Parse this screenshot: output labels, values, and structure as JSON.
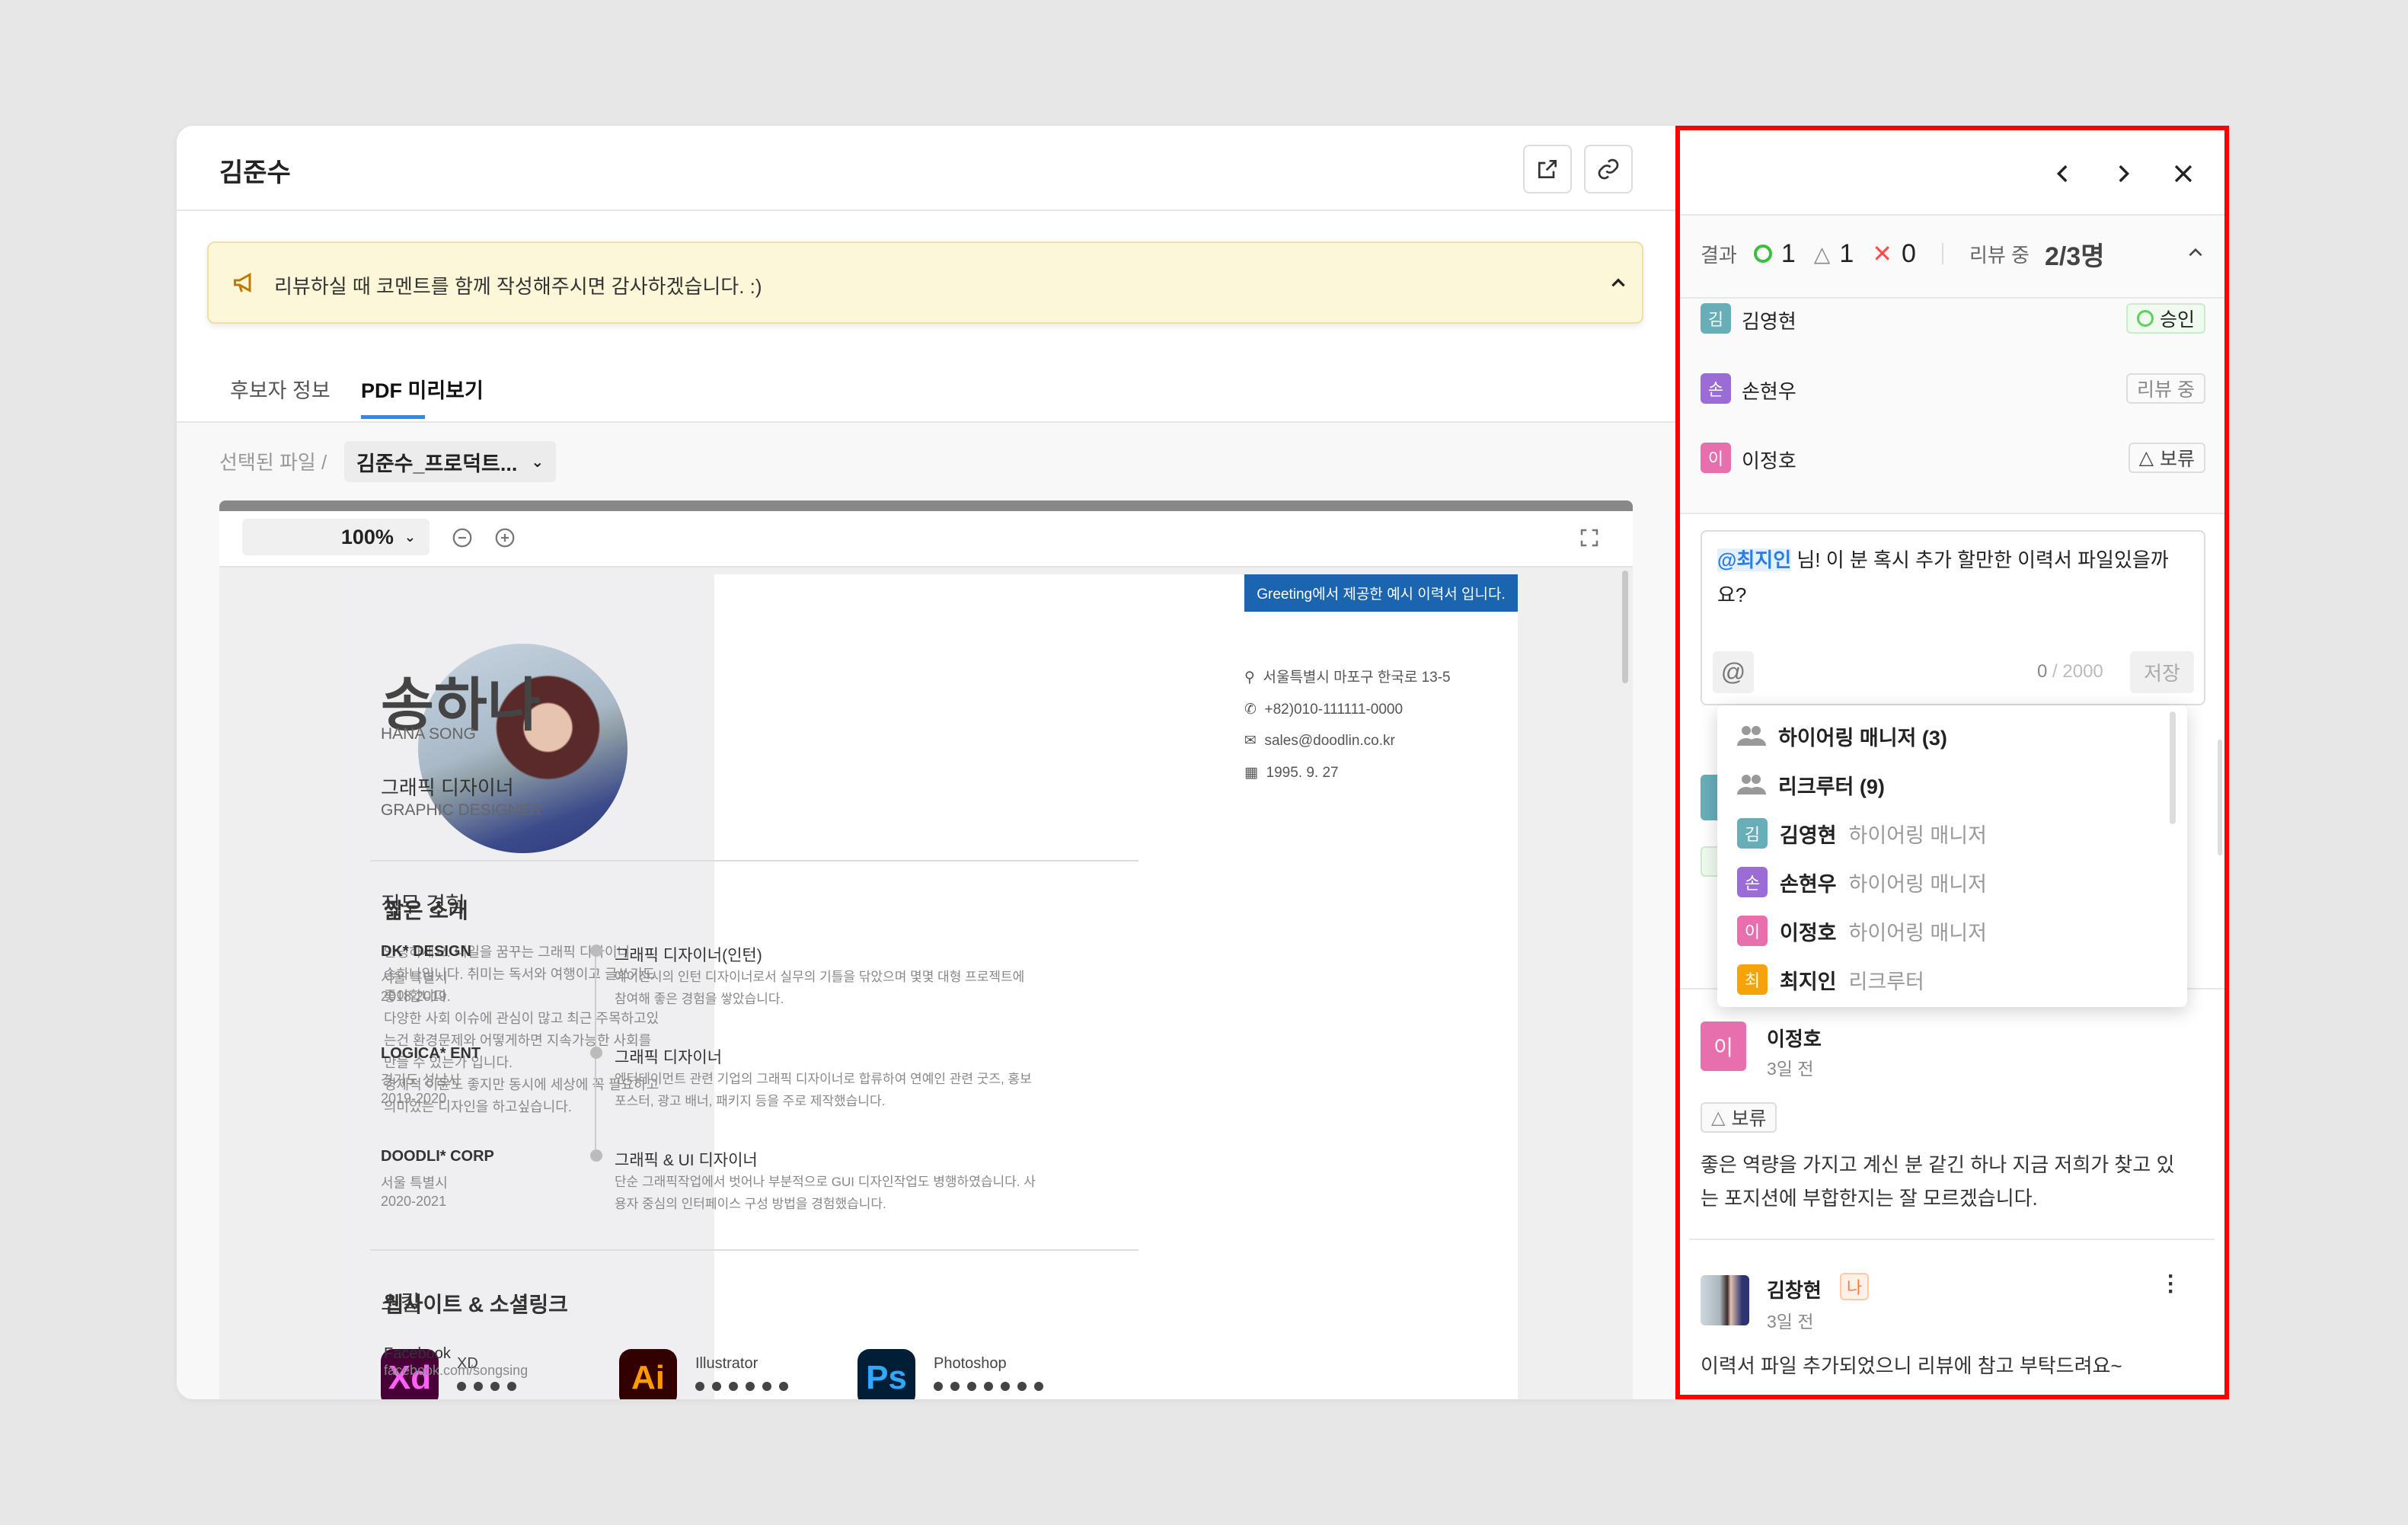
{
  "header": {
    "title": "김준수",
    "icons": [
      "external-link-icon",
      "link-icon"
    ]
  },
  "notice": {
    "text": "리뷰하실 때 코멘트를 함께 작성해주시면 감사하겠습니다. :)",
    "icon": "megaphone-icon"
  },
  "tabs": [
    {
      "label": "후보자 정보"
    },
    {
      "label": "PDF 미리보기",
      "active": true
    }
  ],
  "file_selector": {
    "label": "선택된 파일 /",
    "value": "김준수_프로덕트..."
  },
  "viewer": {
    "zoom": "100%"
  },
  "resume": {
    "banner": "Greeting에서 제공한 예시 이력서 입니다.",
    "name": "송하나",
    "name_en": "HANA SONG",
    "title": "그래픽 디자이너",
    "title_en": "GRAPHIC DESIGNER",
    "contacts": [
      {
        "icon": "location-icon",
        "text": "서울특별시 마포구 한국로 13-5"
      },
      {
        "icon": "phone-icon",
        "text": "+82)010-111111-0000"
      },
      {
        "icon": "mail-icon",
        "text": "sales@doodlin.co.kr"
      },
      {
        "icon": "calendar-icon",
        "text": "1995. 9. 27"
      }
    ],
    "intro_title": "짧은 소개",
    "intro_lines": [
      "안녕하세요. 내일을 꿈꾸는 그래픽 디자이너",
      "송하나입니다. 취미는 독서와 여행이고 글쓰기도",
      "좋아합니다.",
      "다양한 사회 이슈에 관심이 많고 최근 주목하고있",
      "는건 환경문제와 어떻게하면 지속가능한 사회를",
      "만들 수 있는가 입니다.",
      "경제적 이윤도 좋지만 동시에 세상에 꼭 필요하고",
      "의미있는 디자인을 하고싶습니다."
    ],
    "links_title": "웹사이트 & 소셜링크",
    "links": [
      {
        "name": "Facebook",
        "url": "facebook.com/songsing"
      }
    ],
    "experience_title": "직무 경험",
    "experience": [
      {
        "company": "DK* DESIGN",
        "location": "서울 특별시",
        "period": "2018-2019",
        "role": "그래픽 디자이너(인턴)",
        "desc1": "에이전시의 인턴 디자이너로서 실무의 기틀을 닦았으며 몇몇 대형 프로젝트에",
        "desc2": "참여해 좋은 경험을 쌓았습니다."
      },
      {
        "company": "LOGICA* ENT",
        "location": "경기도 성남시",
        "period": "2019-2020",
        "role": "그래픽 디자이너",
        "desc1": "엔터테이먼트 관련 기업의 그래픽 디자이너로 합류하여 연예인 관련 굿즈, 홍보",
        "desc2": "포스터, 광고 배너, 패키지 등을 주로 제작했습니다."
      },
      {
        "company": "DOODLI* CORP",
        "location": "서울 특별시",
        "period": "2020-2021",
        "role": "그래픽 & UI 디자이너",
        "desc1": "단순 그래픽작업에서 벗어나 부분적으로 GUI 디자인작업도 병행하였습니다. 사",
        "desc2": "용자 중심의 인터페이스 구성 방법을 경험했습니다."
      }
    ],
    "skills_title": "스킬",
    "skills": [
      {
        "logo": "Xd",
        "name": "XD",
        "level": 4,
        "bg": "#470137",
        "fg": "#ff61f6"
      },
      {
        "logo": "Ai",
        "name": "Illustrator",
        "level": 6,
        "bg": "#330000",
        "fg": "#ff9a00"
      },
      {
        "logo": "Ps",
        "name": "Photoshop",
        "level": 7,
        "bg": "#001e36",
        "fg": "#31a8ff"
      }
    ]
  },
  "panel": {
    "summary": {
      "label": "결과",
      "approve": "1",
      "hold": "1",
      "reject": "0",
      "reviewing_label": "리뷰 중",
      "reviewing": "2/3명"
    },
    "reviewers": [
      {
        "initial": "김",
        "name": "김영현",
        "status": "승인",
        "color": "#67aeb9"
      },
      {
        "initial": "손",
        "name": "손현우",
        "status": "리뷰 중",
        "color": "#9b6cd6"
      },
      {
        "initial": "이",
        "name": "이정호",
        "status": "보류",
        "color": "#e86fae"
      }
    ],
    "composer": {
      "mention": "@최지인",
      "text": " 님! 이 분 혹시 추가 할만한 이력서 파일있을까요?",
      "count": "0",
      "max": "/ 2000",
      "save": "저장"
    },
    "mention_options": [
      {
        "type": "group",
        "label": "하이어링 매니저 (3)"
      },
      {
        "type": "group",
        "label": "리크루터 (9)"
      },
      {
        "initial": "김",
        "name": "김영현",
        "role": "하이어링 매니저",
        "color": "#67aeb9"
      },
      {
        "initial": "손",
        "name": "손현우",
        "role": "하이어링 매니저",
        "color": "#9b6cd6"
      },
      {
        "initial": "이",
        "name": "이정호",
        "role": "하이어링 매니저",
        "color": "#e86fae"
      },
      {
        "initial": "최",
        "name": "최지인",
        "role": "리크루터",
        "color": "#f5a30a"
      }
    ],
    "comments": [
      {
        "initial": "이",
        "name": "이정호",
        "time": "3일 전",
        "status": "보류",
        "line1": "좋은 역량을 가지고 계신 분 같긴 하나 지금 저희가 찾고 있",
        "line2": "는 포지션에 부합한지는 잘 모르겠습니다."
      },
      {
        "name": "김창현",
        "me": "나",
        "time": "3일 전",
        "text": "이력서 파일 추가되었으니 리뷰에 참고 부탁드려요~"
      }
    ],
    "colors": {
      "approve": "#3cbf3c",
      "reject": "#ff4d4d",
      "highlight": "#2a7de1",
      "border": "#ff0000"
    }
  }
}
